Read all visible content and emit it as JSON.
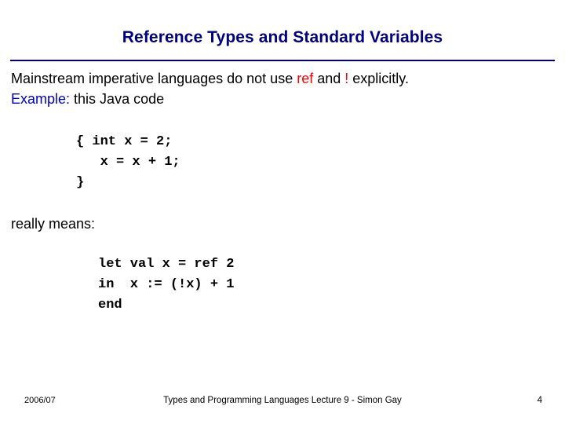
{
  "slide": {
    "title": "Reference Types and Standard Variables",
    "intro": {
      "prefix": "Mainstream imperative languages do not use ",
      "keyword_ref": "ref",
      "middle": " and ",
      "keyword_bang": "!",
      "suffix": " explicitly.",
      "example_label": "Example",
      "example_colon": ":",
      "example_text": " this Java code"
    },
    "java_code": "{ int x = 2;\n   x = x + 1;\n}",
    "really_means": "really means:",
    "sml_code": "let val x = ref 2\nin  x := (!x) + 1\nend",
    "footer": {
      "date": "2006/07",
      "center": "Types and Programming Languages Lecture 9 - Simon Gay",
      "page": "4"
    },
    "colors": {
      "title": "#000080",
      "rule": "#000080",
      "keyword": "#ff0000",
      "example": "#0000cc",
      "text": "#000000"
    }
  }
}
